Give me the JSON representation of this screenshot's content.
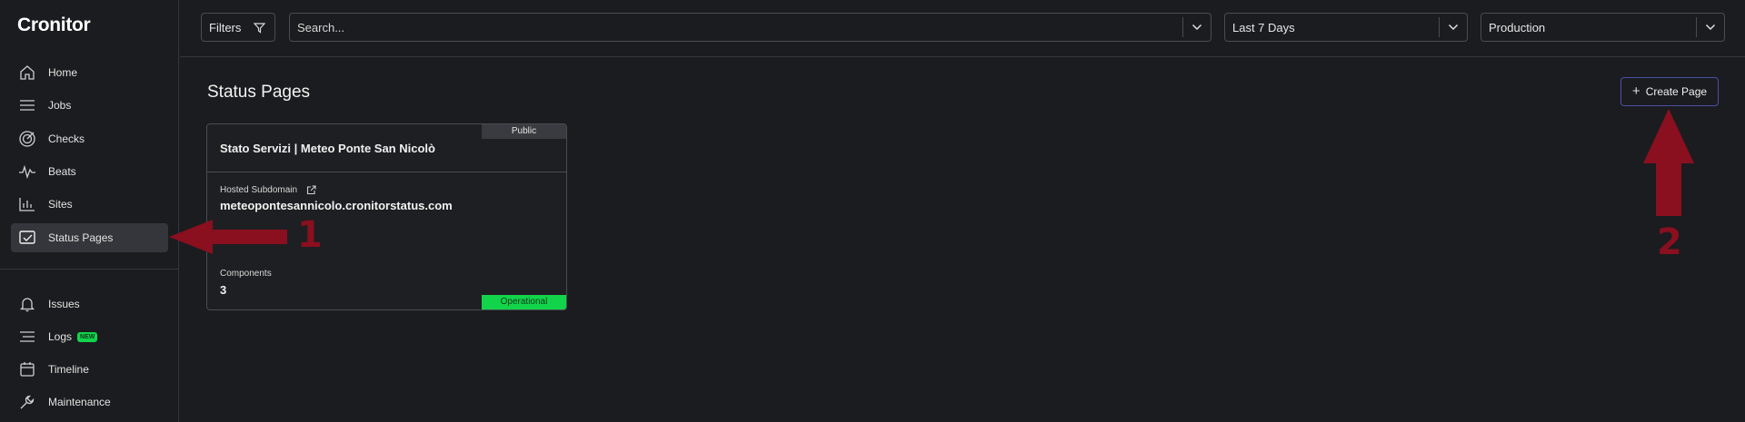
{
  "app": {
    "logo": "Cronitor"
  },
  "sidebar": {
    "items": [
      {
        "label": "Home",
        "icon": "home-icon"
      },
      {
        "label": "Jobs",
        "icon": "list-icon"
      },
      {
        "label": "Checks",
        "icon": "target-icon"
      },
      {
        "label": "Beats",
        "icon": "pulse-icon"
      },
      {
        "label": "Sites",
        "icon": "bar-chart-icon"
      },
      {
        "label": "Status Pages",
        "icon": "status-page-icon",
        "active": true
      },
      {
        "label": "Issues",
        "icon": "bell-icon"
      },
      {
        "label": "Logs",
        "icon": "logs-icon",
        "badge": "NEW"
      },
      {
        "label": "Timeline",
        "icon": "calendar-icon"
      },
      {
        "label": "Maintenance",
        "icon": "wrench-icon"
      }
    ]
  },
  "topbar": {
    "filters_label": "Filters",
    "search_placeholder": "Search...",
    "date_range": "Last 7 Days",
    "environment": "Production"
  },
  "main": {
    "title": "Status Pages",
    "create_button": "Create Page",
    "card": {
      "visibility": "Public",
      "title": "Stato Servizi | Meteo Ponte San Nicolò",
      "subdomain_label": "Hosted Subdomain",
      "subdomain": "meteopontesannicolo.cronitorstatus.com",
      "components_label": "Components",
      "components_count": "3",
      "status": "Operational"
    }
  },
  "annotations": {
    "arrow1_label": "1",
    "arrow2_label": "2"
  },
  "colors": {
    "background": "#1b1c1f",
    "accent_green": "#12d44a",
    "annotation_red": "#8a0f1f",
    "button_border": "#4b4fa8"
  }
}
